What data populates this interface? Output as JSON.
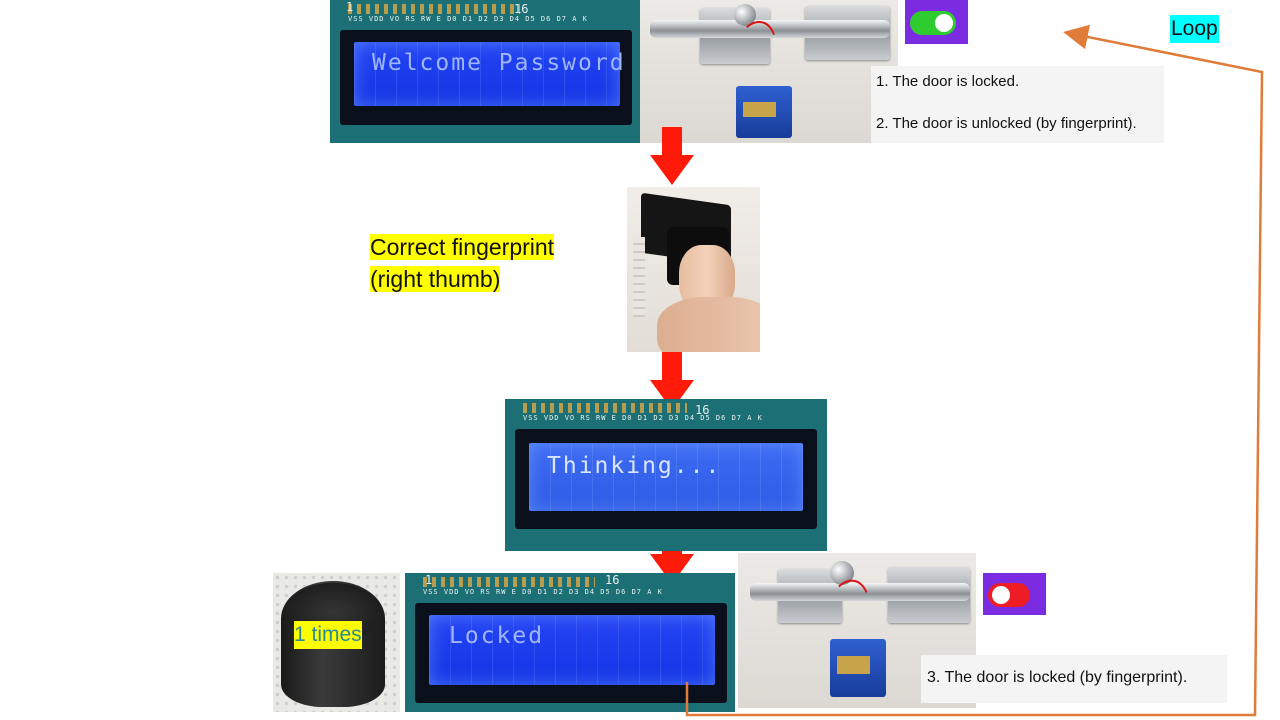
{
  "lcd_screens": {
    "welcome": "Welcome Password",
    "thinking": "Thinking...",
    "locked": "Locked"
  },
  "lcd_pin_labels": "VSS VDD VO RS RW E  D0 D1 D2 D3 D4 D5 D6 D7 A  K",
  "lcd_numbers": {
    "left": "1",
    "right": "16"
  },
  "notes": {
    "locked": "1. The door is locked.",
    "unlocked": "2. The door is unlocked (by fingerprint).",
    "locked_by_fingerprint": "3. The door is locked (by fingerprint)."
  },
  "fingerprint_label": {
    "line1": "Correct fingerprint",
    "line2": "(right thumb)"
  },
  "buzzer_label": "1 times",
  "loop_label": "Loop",
  "toggles": {
    "top": {
      "state": "on",
      "color": "#2ecc2e"
    },
    "bottom": {
      "state": "off",
      "color": "#ee1c25"
    }
  },
  "colors": {
    "arrow": "#ff1a0a",
    "loop_line": "#e07b39",
    "highlight_yellow": "#ffff00",
    "highlight_cyan": "#00ffff",
    "toggle_panel": "#7b2be0",
    "lcd_screen": "#1437f2"
  }
}
